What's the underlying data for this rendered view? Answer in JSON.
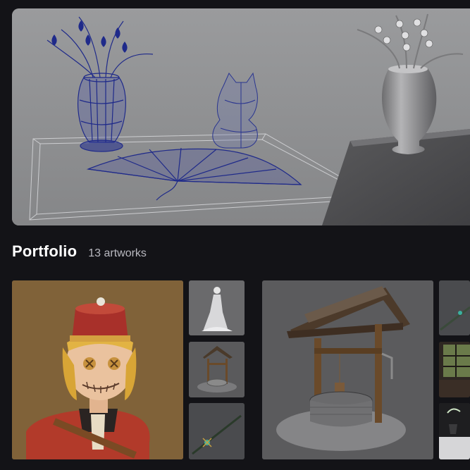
{
  "hero": {
    "image": "3D scene: wireframe vase with lily of the valley flowers, cat figurine and folding fan on a tray; shaded vase and table on the right"
  },
  "portfolio": {
    "title": "Portfolio",
    "count_label": "13 artworks"
  },
  "artworks": [
    {
      "name": "toy soldier bust"
    },
    {
      "name": "white figure sculpt"
    },
    {
      "name": "small wishing well"
    },
    {
      "name": "ornate spear"
    },
    {
      "name": "wishing well"
    },
    {
      "name": "spear detail"
    },
    {
      "name": "japanese room"
    },
    {
      "name": "vase scene"
    }
  ]
}
